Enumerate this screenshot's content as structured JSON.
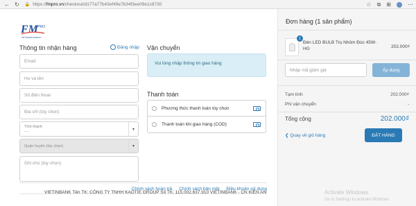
{
  "browser": {
    "url_scheme": "https://",
    "url_host": "fmpro.vn",
    "url_path": "/checkout/d177a77b43ef49e7b34f3ee09e1c8730"
  },
  "brand": {
    "logo_text": "FM",
    "logo_sup": "PRO",
    "logo_tagline": "FM SMART ENERGY"
  },
  "shipping_info": {
    "title": "Thông tin nhận hàng",
    "login_label": "Đăng nhập",
    "email_placeholder": "Email",
    "name_placeholder": "Họ và tên",
    "phone_placeholder": "Số điện thoại",
    "address_placeholder": "Địa chỉ (tùy chọn)",
    "province_label": "Tỉnh thành",
    "province_value": "---",
    "district_label": "Quận huyện (tùy chọn)",
    "note_placeholder": "Ghi chú (tùy chọn)"
  },
  "shipping": {
    "title": "Vận chuyển",
    "notice": "Vui lòng nhập thông tin giao hàng"
  },
  "payment": {
    "title": "Thanh toán",
    "options": [
      "Phương thức thanh toán tùy chọn",
      "Thanh toán khi giao hàng (COD)"
    ]
  },
  "footer": {
    "links": [
      "Chính sách hoàn trả",
      "Chính sách bảo mật",
      "Điều khoản sử dụng"
    ],
    "bank_line": "VIETINBANK Tên TK: CÔNG TY TNHH KAOTIE GROUP Số TK: 115.002.637.910 VIETINBANK - CN KIÊN AN"
  },
  "order": {
    "title": "Đơn hàng (1 sản phẩm)",
    "item_count_badge": "1",
    "product_name": "Đèn LED BULB Trụ Nhôm Đúc 45W-HG",
    "product_price": "202.000₫",
    "coupon_placeholder": "Nhập mã giảm giá",
    "apply_label": "Áp dụng",
    "subtotal_label": "Tạm tính",
    "subtotal_value": "202.000₫",
    "shipping_fee_label": "Phí vận chuyển",
    "shipping_fee_value": "-",
    "total_label": "Tổng cộng",
    "total_value": "202.000₫",
    "back_label": "❮ Quay về giỏ hàng",
    "place_order_label": "ĐẶT HÀNG"
  },
  "watermark": {
    "line1": "Activate Windows",
    "line2": "Go to Settings to activate Windows."
  },
  "colors": {
    "accent": "#2a7ab5",
    "info_bg": "#d9eef6",
    "summary_bg": "#f5f5f5"
  }
}
